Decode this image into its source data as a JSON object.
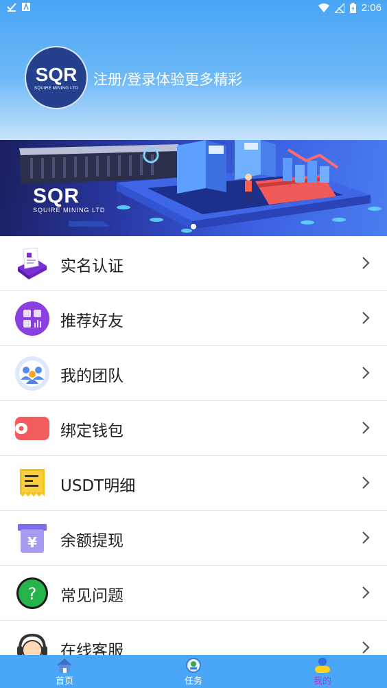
{
  "status_bar": {
    "time": "2:06"
  },
  "profile": {
    "logo_main": "SQR",
    "logo_sub": "SQUIRE MINING LTD",
    "login_prompt": "注册/登录体验更多精彩"
  },
  "banner": {
    "logo_main": "SQR",
    "logo_sub": "SQUIRE MINING LTD"
  },
  "menu": {
    "items": [
      {
        "label": "实名认证",
        "icon": "id-verification-icon"
      },
      {
        "label": "推荐好友",
        "icon": "recommend-friends-icon"
      },
      {
        "label": "我的团队",
        "icon": "team-icon"
      },
      {
        "label": "绑定钱包",
        "icon": "wallet-icon"
      },
      {
        "label": "USDT明细",
        "icon": "receipt-icon"
      },
      {
        "label": "余额提现",
        "icon": "withdraw-icon"
      },
      {
        "label": "常见问题",
        "icon": "question-icon"
      },
      {
        "label": "在线客服",
        "icon": "customer-service-icon"
      }
    ]
  },
  "bottom_nav": {
    "tabs": [
      {
        "label": "首页",
        "icon": "home-icon"
      },
      {
        "label": "任务",
        "icon": "task-icon"
      },
      {
        "label": "我的",
        "icon": "profile-icon",
        "active": true
      }
    ],
    "active_color": "#e21fd0"
  },
  "colors": {
    "header_blue": "#48a5f6",
    "nav_blue": "#4aa6f6"
  }
}
